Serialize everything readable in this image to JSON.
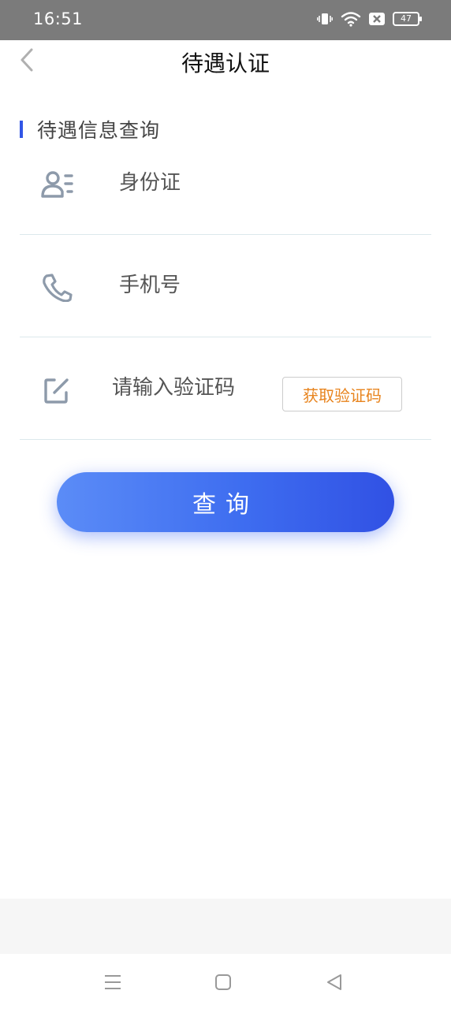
{
  "status_bar": {
    "time": "16:51",
    "battery": "47"
  },
  "header": {
    "title": "待遇认证"
  },
  "section": {
    "title": "待遇信息查询"
  },
  "form": {
    "id_card_placeholder": "身份证",
    "phone_placeholder": "手机号",
    "code_placeholder": "请输入验证码",
    "get_code_label": "获取验证码"
  },
  "query_button": {
    "label": "查询"
  },
  "colors": {
    "accent": "#3256e6",
    "button_gradient_start": "#5b8cf7",
    "button_gradient_end": "#3151e4",
    "get_code_text": "#e8841e",
    "status_bar": "#7b7b7b"
  },
  "icons": {
    "id_card": "person-list-icon",
    "phone": "phone-icon",
    "code": "edit-icon",
    "back": "chevron-left-icon",
    "sys_menu": "menu-icon",
    "sys_home": "home-square-icon",
    "sys_back": "back-triangle-icon"
  }
}
